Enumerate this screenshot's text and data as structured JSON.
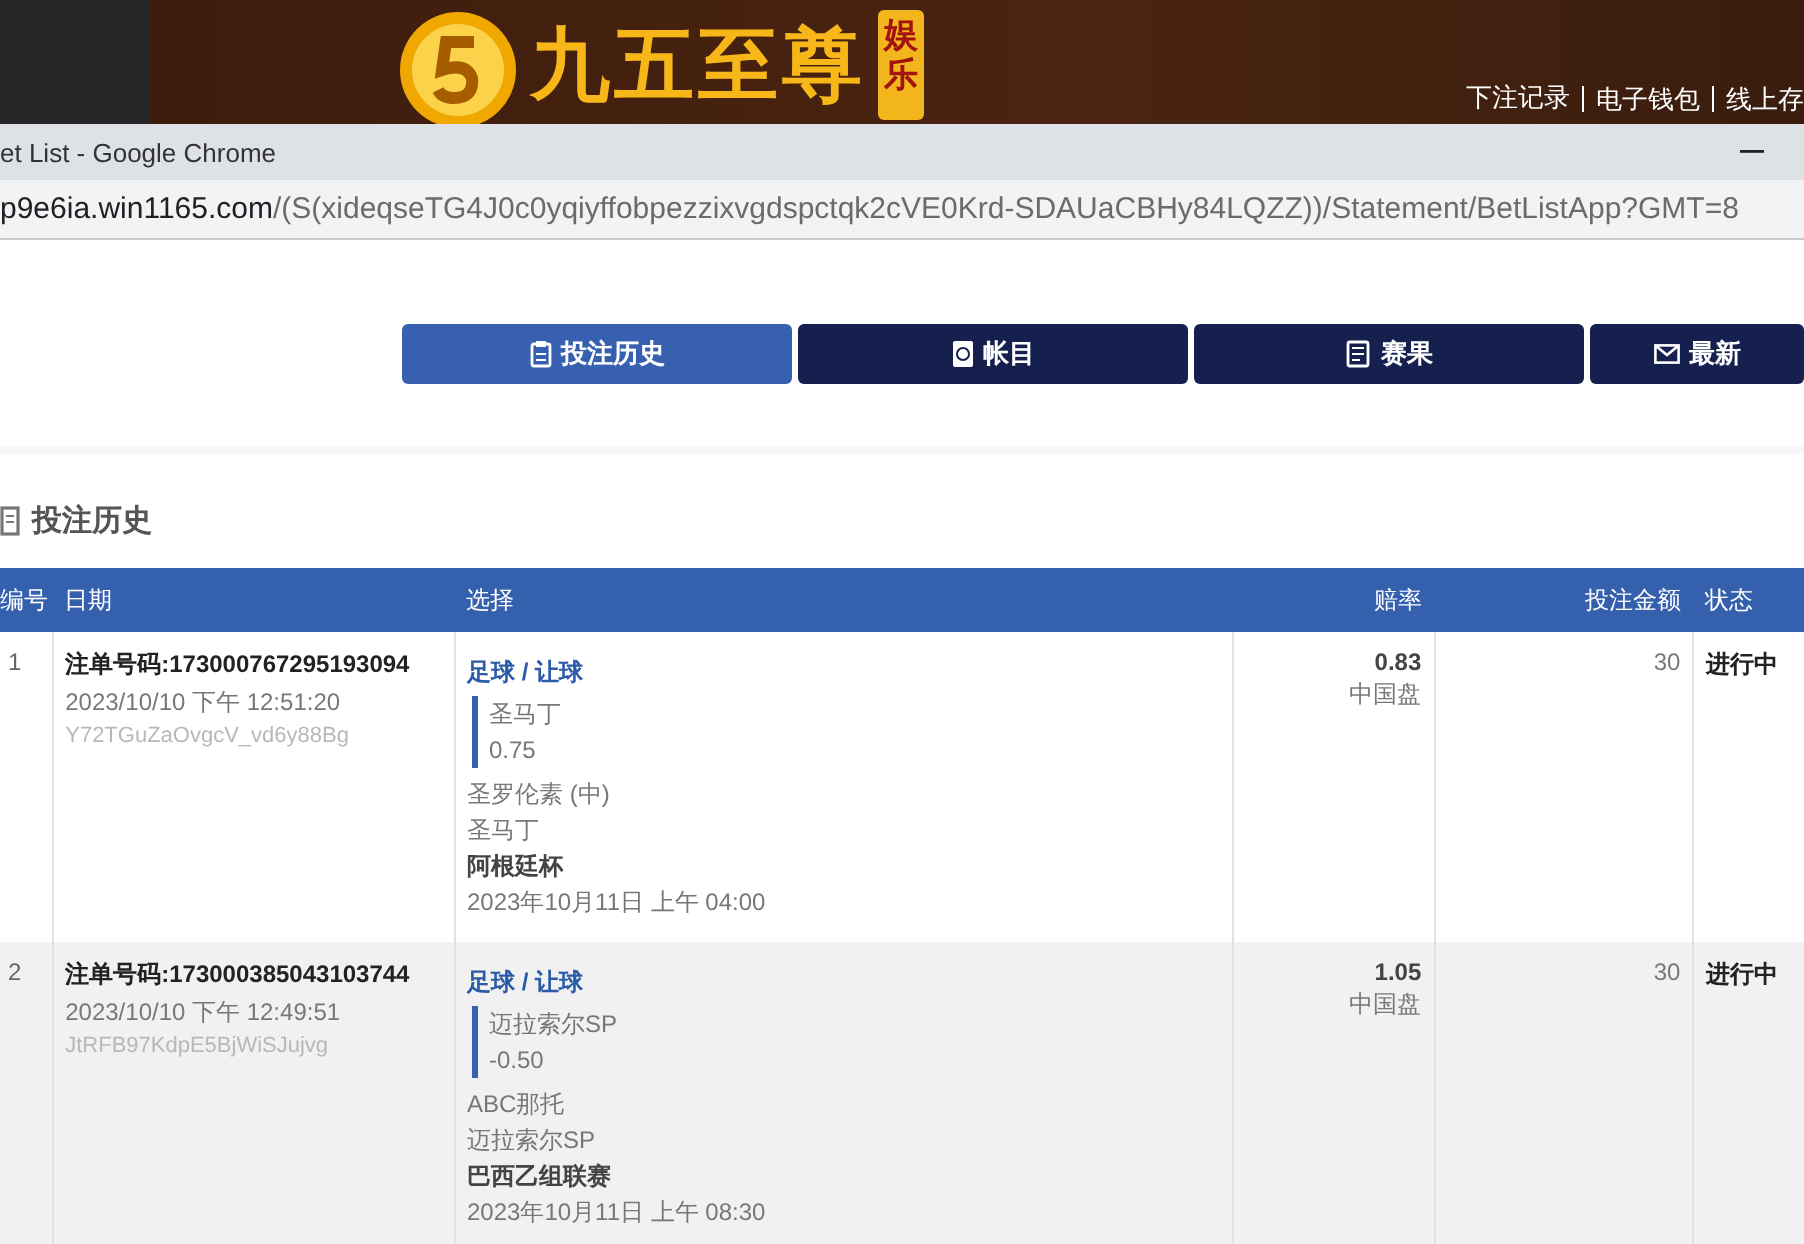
{
  "banner": {
    "logo_title": "九五至尊",
    "badge": "娱乐",
    "links": [
      "下注记录",
      "电子钱包",
      "线上存"
    ]
  },
  "browser": {
    "title": "et List - Google Chrome",
    "url_domain": "p9e6ia.win1165.com",
    "url_path": "/(S(xideqseTG4J0c0yqiyffobpezzixvgdspctqk2cVE0Krd-SDAUaCBHy84LQZZ))/Statement/BetListApp?GMT=8"
  },
  "tabs": [
    {
      "label": "投注历史",
      "selected": true,
      "kind": "history"
    },
    {
      "label": "帐目",
      "selected": false,
      "kind": "account"
    },
    {
      "label": "赛果",
      "selected": false,
      "kind": "results"
    },
    {
      "label": "最新",
      "selected": false,
      "kind": "mail"
    }
  ],
  "section_title": "投注历史",
  "table": {
    "columns": [
      "编号",
      "日期",
      "选择",
      "赔率",
      "投注金额",
      "状态"
    ],
    "rows": [
      {
        "number": "1",
        "ticket": "注单号码:173000767295193094",
        "placed": "2023/10/10 下午 12:51:20",
        "ref": "Y72TGuZaOvgcV_vd6y88Bg",
        "market": "足球 / 让球",
        "pick": "圣马丁",
        "line": "0.75",
        "home": "圣罗伦素 (中)",
        "away": "圣马丁",
        "league": "阿根廷杯",
        "kickoff": "2023年10月11日 上午 04:00",
        "odds": "0.83",
        "odds_type": "中国盘",
        "stake": "30",
        "status": "进行中"
      },
      {
        "number": "2",
        "ticket": "注单号码:173000385043103744",
        "placed": "2023/10/10 下午 12:49:51",
        "ref": "JtRFB97KdpE5BjWiSJujvg",
        "market": "足球 / 让球",
        "pick": "迈拉索尔SP",
        "line": "-0.50",
        "home": "ABC那托",
        "away": "迈拉索尔SP",
        "league": "巴西乙组联赛",
        "kickoff": "2023年10月11日 上午 08:30",
        "odds": "1.05",
        "odds_type": "中国盘",
        "stake": "30",
        "status": "进行中"
      }
    ]
  }
}
